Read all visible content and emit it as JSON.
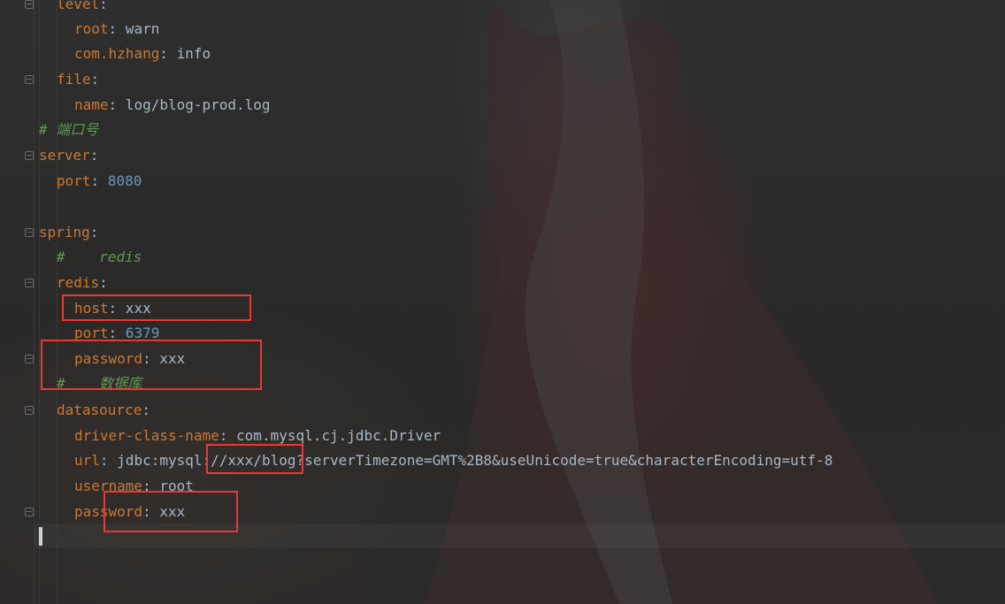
{
  "editor": {
    "lines": [
      {
        "key": "level",
        "sep": ":",
        "value": "",
        "value_class": "v",
        "comment": ""
      },
      {
        "key": "root",
        "sep": ":",
        "value": " warn",
        "value_class": "v",
        "comment": ""
      },
      {
        "key": "com.hzhang",
        "sep": ":",
        "value": " info",
        "value_class": "v",
        "comment": ""
      },
      {
        "key": "file",
        "sep": ":",
        "value": "",
        "value_class": "v",
        "comment": ""
      },
      {
        "key": "name",
        "sep": ":",
        "value": " log/blog-prod.log",
        "value_class": "v",
        "comment": ""
      },
      {
        "key": "",
        "sep": "",
        "value": "",
        "value_class": "v",
        "comment": "# 端口号"
      },
      {
        "key": "server",
        "sep": ":",
        "value": "",
        "value_class": "v",
        "comment": ""
      },
      {
        "key": "port",
        "sep": ":",
        "value": " 8080",
        "value_class": "n",
        "comment": ""
      },
      {
        "key": "",
        "sep": "",
        "value": "",
        "value_class": "v",
        "comment": ""
      },
      {
        "key": "spring",
        "sep": ":",
        "value": "",
        "value_class": "v",
        "comment": ""
      },
      {
        "key": "",
        "sep": "",
        "value": "",
        "value_class": "v",
        "comment": "#    redis"
      },
      {
        "key": "redis",
        "sep": ":",
        "value": "",
        "value_class": "v",
        "comment": ""
      },
      {
        "key": "host",
        "sep": ":",
        "value": " xxx",
        "value_class": "v",
        "comment": ""
      },
      {
        "key": "port",
        "sep": ":",
        "value": " 6379",
        "value_class": "n",
        "comment": ""
      },
      {
        "key": "password",
        "sep": ":",
        "value": " xxx",
        "value_class": "v",
        "comment": ""
      },
      {
        "key": "",
        "sep": "",
        "value": "",
        "value_class": "v",
        "comment": "#    数据库"
      },
      {
        "key": "datasource",
        "sep": ":",
        "value": "",
        "value_class": "v",
        "comment": ""
      },
      {
        "key": "driver-class-name",
        "sep": ":",
        "value": " com.mysql.cj.jdbc.Driver",
        "value_class": "v",
        "comment": ""
      },
      {
        "key": "url",
        "sep": ":",
        "value": " jdbc:mysql://xxx/blog?serverTimezone=GMT%2B8&useUnicode=true&characterEncoding=utf-8",
        "value_class": "v",
        "comment": ""
      },
      {
        "key": "username",
        "sep": ":",
        "value": " root",
        "value_class": "v",
        "comment": ""
      },
      {
        "key": "password",
        "sep": ":",
        "value": " xxx",
        "value_class": "v",
        "comment": ""
      },
      {
        "key": "",
        "sep": "",
        "value": "",
        "value_class": "v",
        "comment": ""
      }
    ]
  },
  "theme": {
    "key_color": "#cc7832",
    "value_color": "#a9b7c6",
    "number_color": "#6897bb",
    "comment_color": "#629755",
    "highlight_color": "#e53935"
  }
}
